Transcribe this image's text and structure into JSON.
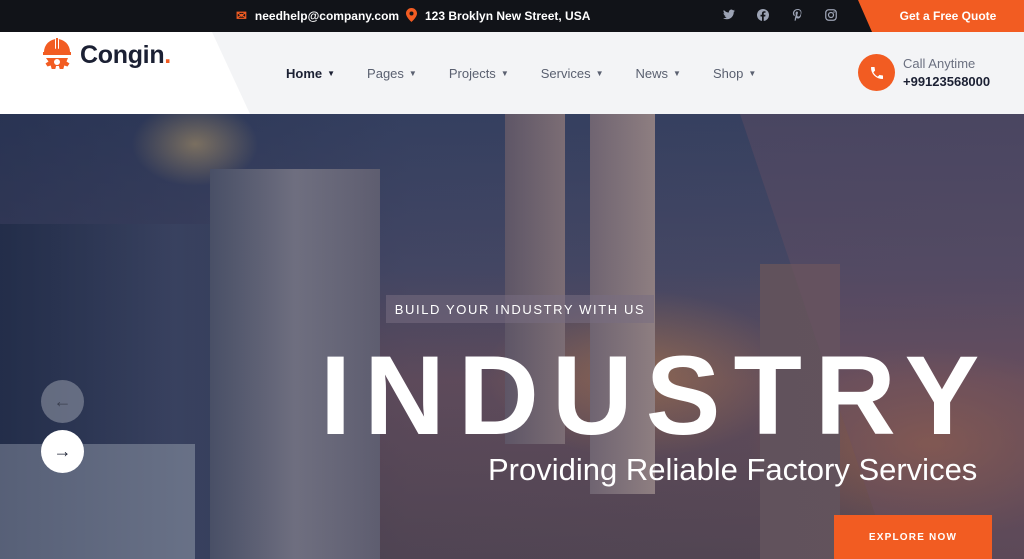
{
  "topbar": {
    "email": "needhelp@company.com",
    "email_icon": "envelope-icon",
    "address": "123 Broklyn New Street, USA",
    "address_icon": "map-pin-icon",
    "socials": [
      "twitter-icon",
      "facebook-icon",
      "pinterest-icon",
      "instagram-icon"
    ],
    "quote_button": "Get a Free Quote"
  },
  "header": {
    "logo_text": "Congin",
    "logo_dot": ".",
    "nav": [
      {
        "label": "Home",
        "active": true
      },
      {
        "label": "Pages"
      },
      {
        "label": "Projects"
      },
      {
        "label": "Services"
      },
      {
        "label": "News"
      },
      {
        "label": "Shop"
      }
    ],
    "call_label": "Call Anytime",
    "call_number": "+99123568000"
  },
  "hero": {
    "tagline": "BUILD YOUR INDUSTRY WITH US",
    "headline": "INDUSTRY",
    "subline": "Providing Reliable Factory Services",
    "cta": "EXPLORE NOW"
  },
  "colors": {
    "accent": "#f25c22",
    "dark": "#111318",
    "text": "#1b2033"
  }
}
